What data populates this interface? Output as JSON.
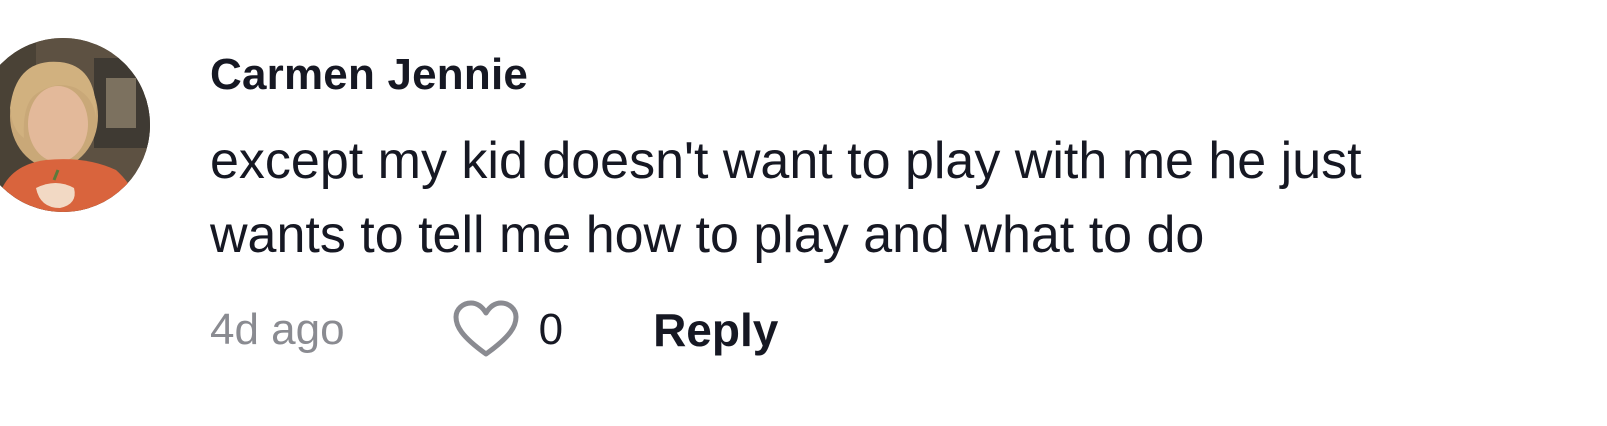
{
  "comment": {
    "author": "Carmen Jennie",
    "text_lines": [
      "except my kid doesn't want to play with me he just",
      "wants to tell me how to play and what to do"
    ],
    "timestamp": "4d ago",
    "like_count": "0",
    "reply_label": "Reply",
    "like_icon": "heart-outline-icon"
  },
  "colors": {
    "text_primary": "#161823",
    "text_secondary": "#8a8b91",
    "icon_stroke": "#8a8b91"
  }
}
